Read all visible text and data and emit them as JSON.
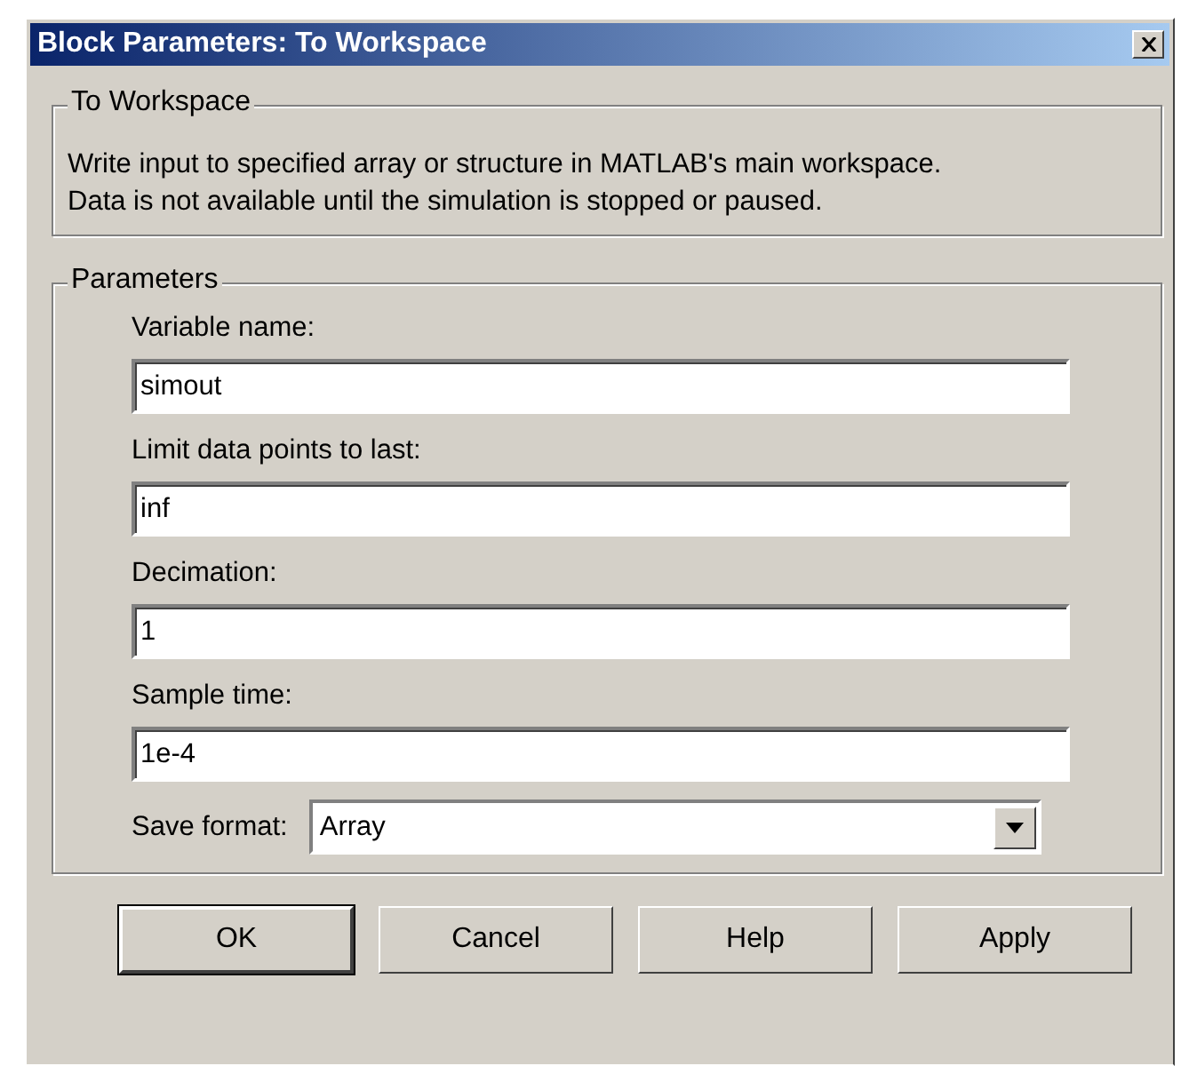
{
  "window": {
    "title": "Block Parameters: To Workspace"
  },
  "description_group": {
    "title": "To Workspace",
    "text": "Write input to specified array or structure in MATLAB's main workspace.\nData is not available until the simulation is stopped or paused."
  },
  "parameters_group": {
    "title": "Parameters",
    "fields": [
      {
        "label": "Variable name:",
        "value": "simout"
      },
      {
        "label": "Limit data points to last:",
        "value": "inf"
      },
      {
        "label": "Decimation:",
        "value": "1"
      },
      {
        "label": "Sample time:",
        "value": "1e-4"
      }
    ],
    "save_format": {
      "label": "Save format:",
      "value": "Array"
    }
  },
  "buttons": [
    {
      "label": "OK",
      "default": true
    },
    {
      "label": "Cancel",
      "default": false
    },
    {
      "label": "Help",
      "default": false
    },
    {
      "label": "Apply",
      "default": false
    }
  ]
}
